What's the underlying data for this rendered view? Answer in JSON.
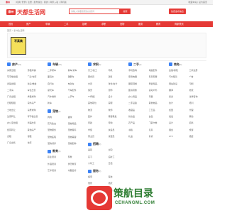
{
  "topbar": {
    "city": "泰州",
    "links": "[切换] 登录 | 注册 | 发布信息 | 我的 | 商家入驻 | 手机版",
    "right": "收藏本站 | 设为首页"
  },
  "header": {
    "logo_text": "泰州",
    "brand": "天都生活网",
    "search_placeholder": "请输入你要搜索的关键词",
    "search_button": "搜索",
    "publish_button": "免费发布信息"
  },
  "nav": {
    "items": [
      "首页",
      "房产",
      "车辆",
      "二手",
      "招聘",
      "求职",
      "宠物",
      "服务",
      "教育",
      "商家黄页"
    ]
  },
  "breadcrumb": "首页 > 泰州生活网",
  "banner": {
    "ad_text": "写真集"
  },
  "columns": [
    {
      "categories": [
        {
          "title": "房产",
          "count": "(93)",
          "links": [
            "房屋出租",
            "整租商铺",
            "写字楼出租",
            "厂房/仓库",
            "商铺出租",
            "新房/楼盘",
            "二手房",
            "车位出售",
            "厂房出租",
            "求租求购",
            "日租短租",
            "海外房产",
            "土地出让",
            "房屋求购",
            "生意转让",
            "写字楼出售",
            "办公室出租",
            "商铺出售",
            "经营转让",
            "其他房产",
            "合租",
            "短租",
            "厂房出售",
            "仓库"
          ]
        }
      ]
    },
    {
      "categories": [
        {
          "title": "车辆",
          "count": "(16)",
          "links": [
            "二手轿车",
            "客车/货车",
            "面包车",
            "越野车",
            "自行车",
            "电动车",
            "摩托车",
            "汽车配件",
            "汽车维修",
            "二手车",
            "新车"
          ]
        },
        {
          "title": "宠物",
          "count": "(0)",
          "links": [
            "狗狗",
            "猫咪",
            "花鸟鱼虫",
            "宠物用品",
            "宠物服务",
            "宠物寄养",
            "宠物医院",
            "宠物美容",
            "宠物领养",
            "宠物配种"
          ]
        },
        {
          "title": "教育",
          "count": "(0)",
          "links": [
            "职业培训",
            "家教",
            "外语培训",
            "学历教育",
            "艺术培训",
            "兴趣爱好"
          ]
        }
      ]
    },
    {
      "categories": [
        {
          "title": "求职",
          "count": "(0)",
          "links": [
            "普工/技工",
            "司机",
            "服务员",
            "销售",
            "文员",
            "财务/会计",
            "保安",
            "厨师",
            "IT/网络",
            "设计",
            "其他职位",
            "客服",
            "物流",
            "教师",
            "医护",
            "美容美发",
            "家政",
            "导购",
            "学徒",
            "快递员",
            "营业员",
            "收银员"
          ]
        },
        {
          "title": "招聘",
          "count": "(0)",
          "links": [
            "兼职",
            "全职",
            "实习",
            "临时工",
            "小时工",
            "日结"
          ]
        },
        {
          "title": "服务",
          "count": "(0)",
          "links": [
            "搬家",
            "保洁",
            "维修",
            "婚庆",
            "摄影",
            "开锁"
          ]
        }
      ]
    },
    {
      "categories": [
        {
          "title": "二手",
          "count": "(0)",
          "links": [
            "手机数码",
            "电脑配件",
            "家用电器",
            "家具家居",
            "服装鞋帽",
            "母婴用品",
            "图书音像",
            "运动户外",
            "办公用品",
            "乐器",
            "二手设备",
            "其他物品",
            "收藏品",
            "工艺品",
            "化妆品",
            "食品",
            "农产品",
            "门票卡券",
            "书籍",
            "玩具",
            "礼品",
            "杂货"
          ]
        }
      ]
    },
    {
      "categories": [
        {
          "title": "商务",
          "count": "(0)",
          "links": [
            "金融/保险",
            "工商注册",
            "汽车租赁",
            "广告",
            "网站建设",
            "印刷",
            "翻译",
            "物流",
            "投资",
            "法律咨询",
            "会计",
            "培训",
            "加盟",
            "代理",
            "批发",
            "其他",
            "设计",
            "招商",
            "展会",
            "旅游",
            "KTV",
            "酒店"
          ]
        }
      ]
    }
  ],
  "watermark": {
    "text": "策航目录",
    "url": "CEHANGML.COM"
  }
}
